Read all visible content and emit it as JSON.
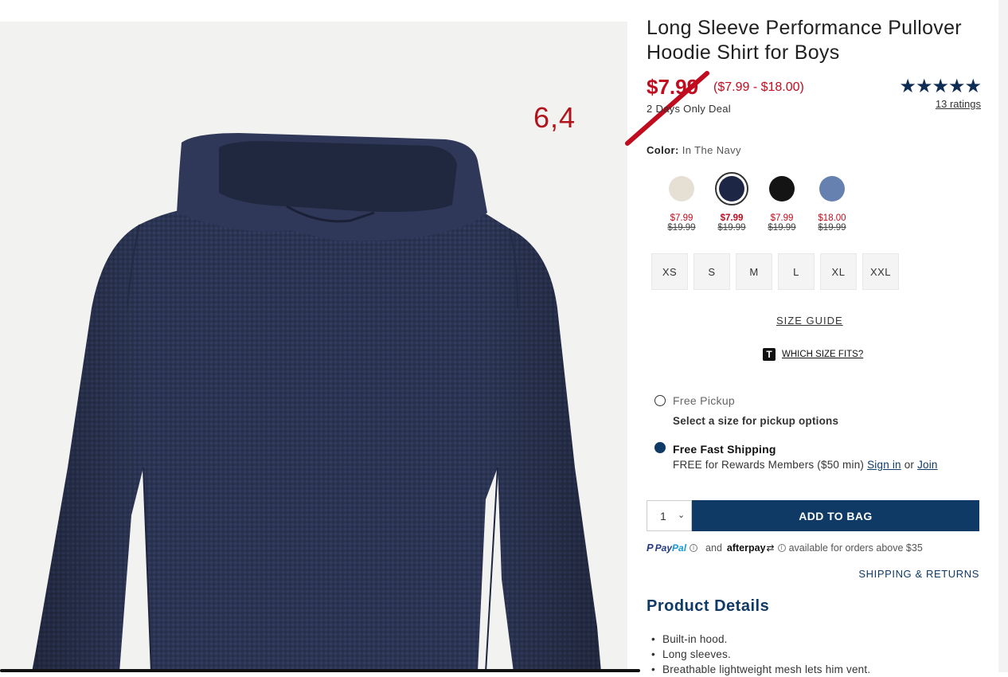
{
  "annotation": {
    "text": "6,4"
  },
  "product": {
    "title": "Long Sleeve Performance Pullover Hoodie Shirt for Boys",
    "price": "$7.99",
    "price_range": "($7.99 - $18.00)",
    "deal": "2 Days Only Deal",
    "stars": "★★★★★",
    "rating_value": 5,
    "ratings_link": "13 ratings"
  },
  "color": {
    "label": "Color:",
    "value": "In The Navy",
    "swatches": [
      {
        "name": "cream",
        "color": "#e6e0d4",
        "sale": "$7.99",
        "orig": "$19.99",
        "selected": false
      },
      {
        "name": "navy",
        "color": "#1e2645",
        "sale": "$7.99",
        "orig": "$19.99",
        "selected": true
      },
      {
        "name": "black",
        "color": "#141414",
        "sale": "$7.99",
        "orig": "$19.99",
        "selected": false
      },
      {
        "name": "blue",
        "color": "#6680b0",
        "sale": "$18.00",
        "orig": "$19.99",
        "selected": false
      }
    ]
  },
  "sizes": [
    "XS",
    "S",
    "M",
    "L",
    "XL",
    "XXL"
  ],
  "size_guide": "SIZE GUIDE",
  "which_size": {
    "badge": "T",
    "label": "WHICH SIZE FITS?"
  },
  "fulfillment": {
    "pickup_label": "Free Pickup",
    "pickup_note": "Select a size for pickup options",
    "shipping_label": "Free Fast Shipping",
    "shipping_note": "FREE for Rewards Members ($50 min)",
    "sign_in": "Sign in",
    "or": "or",
    "join": "Join"
  },
  "purchase": {
    "quantity": "1",
    "add_to_bag": "ADD TO BAG"
  },
  "payment": {
    "paypal_pay": "Pay",
    "paypal_pal": "Pal",
    "and": "and",
    "afterpay": "afterpay",
    "available": "available for orders above $35"
  },
  "shipping_returns": "SHIPPING & RETURNS",
  "details": {
    "heading": "Product Details",
    "items": [
      "Built-in hood.",
      "Long sleeves.",
      "Breathable lightweight mesh lets him vent."
    ]
  },
  "colors": {
    "accent": "#0f3a66",
    "sale_red": "#c00c1e",
    "star_navy": "#0f2d54",
    "image_bg": "#f2f2f0",
    "hoodie": "#2a3350"
  }
}
